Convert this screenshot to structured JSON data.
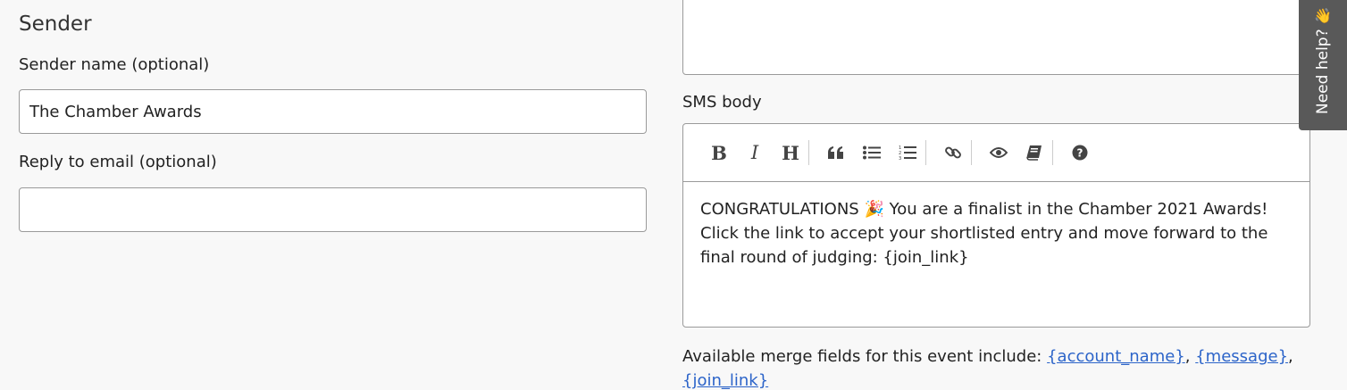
{
  "sender": {
    "section_title": "Sender",
    "name_label": "Sender name",
    "name_optional": "(optional)",
    "name_value": "The Chamber Awards",
    "reply_label": "Reply to email",
    "reply_optional": "(optional)",
    "reply_value": ""
  },
  "sms": {
    "label": "SMS body",
    "body": "CONGRATULATIONS 🎉 You are a finalist in the Chamber 2021 Awards! Click the link to accept your shortlisted entry and move forward to the final round of judging: {join_link}",
    "toolbar": [
      "bold",
      "italic",
      "heading",
      "quote",
      "unordered-list",
      "ordered-list",
      "link",
      "preview",
      "guide",
      "help"
    ]
  },
  "merge_fields": {
    "intro": "Available merge fields for this event include:",
    "fields": [
      "{account_name}",
      "{message}",
      "{join_link}"
    ]
  },
  "help_tab": {
    "label": "Need help?",
    "icon": "👋"
  }
}
